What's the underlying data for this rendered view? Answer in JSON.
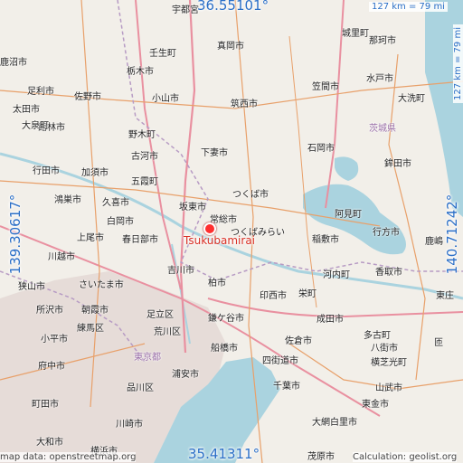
{
  "coords": {
    "top_lat": "36.55101°",
    "bottom_lat": "35.41311°",
    "left_lon": "139.30617°",
    "right_lon": "140.71242°"
  },
  "scale": {
    "top": "127 km = 79 mi",
    "right": "127 km = 79 mi"
  },
  "place": {
    "name": "Tsukubamirai"
  },
  "footer": {
    "attribution": "map data: openstreetmap.org",
    "calculation": "Calculation: geolist.org"
  },
  "colors": {
    "land": "#f2efe9",
    "water": "#aad3df",
    "city": "#e6dcd8",
    "road": "#e8a06a",
    "motorway": "#e990a0",
    "coord_text": "#2b6fc7",
    "marker": "#ff2f2f"
  },
  "cities": [
    "宇都宮",
    "壬生町",
    "真岡市",
    "那珂市",
    "城里町",
    "鹿沼市",
    "栃木市",
    "水戸市",
    "大洗町",
    "足利市",
    "佐野市",
    "小山市",
    "笠間市",
    "太田市",
    "館林市",
    "筑西市",
    "茨城県",
    "大泉町",
    "野木町",
    "古河市",
    "下妻市",
    "石岡市",
    "鉾田市",
    "行田市",
    "加須市",
    "五霞町",
    "鴻巣市",
    "久喜市",
    "つくば市",
    "阿見町",
    "白岡市",
    "坂東市",
    "常総市",
    "行方市",
    "上尾市",
    "春日部市",
    "つくばみらい",
    "稲敷市",
    "鹿嶋",
    "川越市",
    "吉川市",
    "河内町",
    "香取市",
    "狭山市",
    "さいたま市",
    "柏市",
    "印西市",
    "栄町",
    "東庄",
    "所沢市",
    "朝霞市",
    "足立区",
    "鎌ケ谷市",
    "成田市",
    "練馬区",
    "荒川区",
    "佐倉市",
    "多古町",
    "小平市",
    "東京都",
    "船橋市",
    "八街市",
    "匝",
    "府中市",
    "浦安市",
    "四街道市",
    "横芝光町",
    "品川区",
    "千葉市",
    "山武市",
    "町田市",
    "東金市",
    "川崎市",
    "大網白里市",
    "大和市",
    "横浜市",
    "茂原市"
  ]
}
